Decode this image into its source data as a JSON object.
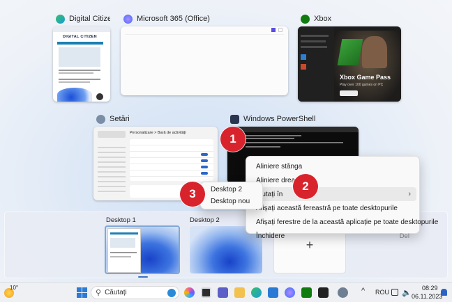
{
  "windows": [
    {
      "title": "Digital Citizen - L...",
      "icon": "edge-icon",
      "color": "#1c9bd8"
    },
    {
      "title": "Microsoft 365 (Office)",
      "icon": "m365-icon",
      "color": "#7b61ff"
    },
    {
      "title": "Xbox",
      "icon": "xbox-icon",
      "color": "#107c10"
    },
    {
      "title": "Setări",
      "icon": "settings-icon",
      "color": "#6e8ca8"
    },
    {
      "title": "Windows PowerShell",
      "icon": "powershell-icon",
      "color": "#1f2a44"
    }
  ],
  "xbox_thumb": {
    "headline": "Xbox Game Pass",
    "subline": "Play over 100 games on PC"
  },
  "dc_thumb": {
    "brand": "DIGITAL CITIZEN"
  },
  "settings_thumb": {
    "heading": "Personalizare > Bară de activități"
  },
  "context_menu": {
    "items": [
      {
        "label": "Aliniere stânga",
        "shortcut": "",
        "submenu": false
      },
      {
        "label": "Aliniere dreapta",
        "shortcut": "",
        "submenu": false
      },
      {
        "label": "Mutați în",
        "shortcut": "",
        "submenu": true
      },
      {
        "label": "Afișați această fereastră pe toate desktopurile",
        "shortcut": "",
        "submenu": false
      },
      {
        "label": "Afișați ferestre de la această aplicație pe toate desktopurile",
        "shortcut": "",
        "submenu": false
      },
      {
        "label": "Închidere",
        "shortcut": "Del",
        "submenu": false
      }
    ]
  },
  "submenu": {
    "items": [
      "Desktop 2",
      "Desktop nou"
    ]
  },
  "badges": [
    "1",
    "2",
    "3"
  ],
  "desktops": {
    "items": [
      {
        "label": "Desktop 1"
      },
      {
        "label": "Desktop 2"
      }
    ],
    "new_label": "+"
  },
  "taskbar": {
    "weather_temp": "10°",
    "search_placeholder": "Căutați",
    "language": "ROU",
    "time": "08:29",
    "date": "06.11.2023"
  }
}
